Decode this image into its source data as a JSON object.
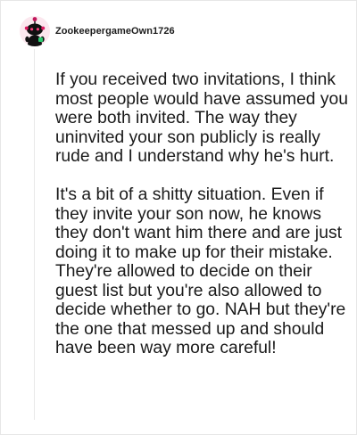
{
  "comment": {
    "author": {
      "username": "ZookeepergameOwn1726",
      "avatar_icon": "snoo-avatar-icon",
      "avatar_bg": "#fbe7ee"
    },
    "paragraphs": [
      "If you received two invitations, I think most people would have assumed you were both invited. The way they uninvited your son publicly is really rude and I understand why he's hurt.",
      "It's a bit of a shitty situation. Even if they invite your son now, he knows they don't want him there and are just doing it to make up for their mistake. They're allowed to decide on their guest list but you're also allowed to decide whether to go. NAH but they're the one that messed up and should have been way more careful!"
    ]
  }
}
